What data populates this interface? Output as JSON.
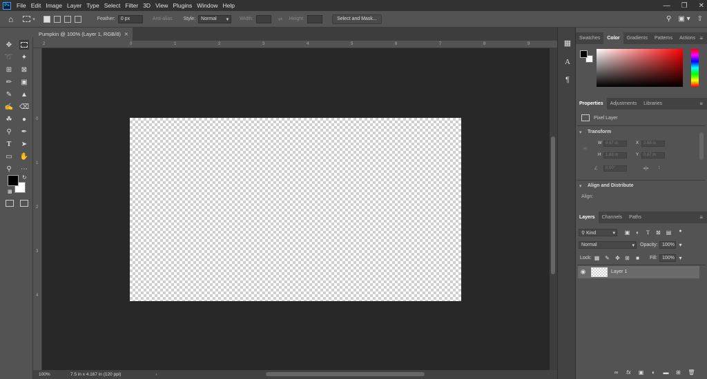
{
  "menu": {
    "app_icon": "Ps",
    "items": [
      "File",
      "Edit",
      "Image",
      "Layer",
      "Type",
      "Select",
      "Filter",
      "3D",
      "View",
      "Plugins",
      "Window",
      "Help"
    ],
    "window_controls": [
      "minimize-icon",
      "restore-icon",
      "close-icon"
    ]
  },
  "options": {
    "feather_label": "Feather:",
    "feather_value": "0 px",
    "antialias_label": "Anti-alias",
    "style_label": "Style:",
    "style_value": "Normal",
    "width_label": "Width:",
    "height_label": "Height:",
    "select_mask_label": "Select and Mask..."
  },
  "document": {
    "tab_title": "Pumpkin @ 100% (Layer 1, RGB/8)",
    "zoom": "100%",
    "doc_info": "7.5 in x 4.167 in (120 ppi)"
  },
  "rulers": {
    "h_labels": [
      "2",
      "0",
      "1",
      "2",
      "3",
      "4",
      "5",
      "6",
      "7",
      "8",
      "9"
    ],
    "v_labels": [
      "0",
      "1",
      "2",
      "3",
      "4"
    ]
  },
  "color_panel": {
    "tabs": [
      "Swatches",
      "Color",
      "Gradients",
      "Patterns",
      "Actions"
    ],
    "active_tab": "Color",
    "foreground": "#000000",
    "background": "#ffffff"
  },
  "properties_panel": {
    "tabs": [
      "Properties",
      "Adjustments",
      "Libraries"
    ],
    "active_tab": "Properties",
    "layer_type": "Pixel Layer",
    "transform_label": "Transform",
    "w_label": "W",
    "h_label": "H",
    "x_label": "X",
    "y_label": "Y",
    "w_value": "0.87 in",
    "h_value": "1.88 in",
    "x_value": "2.68 in",
    "y_value": "0.97 in",
    "angle_value": "0.00°",
    "align_label": "Align and Distribute",
    "align_sub": "Align:"
  },
  "layers_panel": {
    "tabs": [
      "Layers",
      "Channels",
      "Paths"
    ],
    "active_tab": "Layers",
    "filter_kind": "Kind",
    "blend_mode": "Normal",
    "opacity_label": "Opacity:",
    "opacity_value": "100%",
    "lock_label": "Lock:",
    "fill_label": "Fill:",
    "fill_value": "100%",
    "layers": [
      {
        "name": "Layer 1",
        "visible": true
      }
    ]
  },
  "colors": {
    "accent": "#31a8ff",
    "menubar_bg": "#323232",
    "pasteboard": "#282828",
    "panel_bg": "#535353"
  }
}
